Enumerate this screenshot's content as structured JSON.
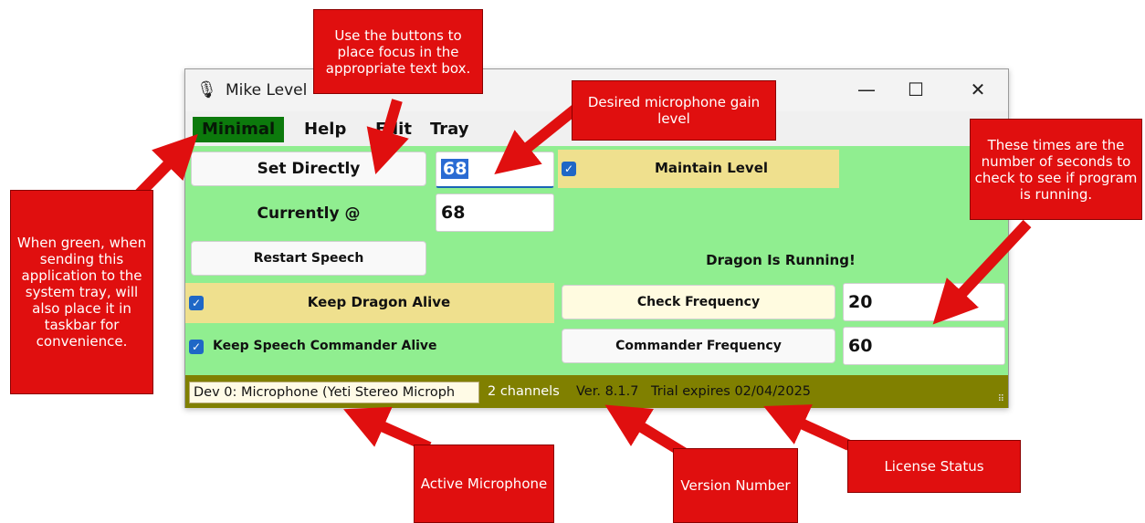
{
  "window": {
    "title": "Mike Level",
    "minimize_glyph": "—",
    "maximize_glyph": "☐",
    "close_glyph": "✕",
    "app_icon": "microphone-icon"
  },
  "menu": {
    "items": [
      "Minimal",
      "Help",
      "Edit",
      "Tray"
    ]
  },
  "controls": {
    "set_directly": "Set Directly",
    "gain_value": "68",
    "maintain_level": "Maintain Level",
    "currently_label": "Currently @",
    "current_value": "68",
    "restart_speech": "Restart Speech",
    "dragon_status": "Dragon Is Running!",
    "keep_dragon_alive": "Keep Dragon Alive",
    "check_frequency": "Check Frequency",
    "check_frequency_value": "20",
    "keep_speech_commander_alive": "Keep Speech Commander Alive",
    "commander_frequency": "Commander Frequency",
    "commander_frequency_value": "60"
  },
  "status": {
    "device": "Dev 0: Microphone (Yeti Stereo Microph",
    "channels": "2 channels",
    "version": "Ver. 8.1.7",
    "license": "Trial expires 02/04/2025"
  },
  "callouts": {
    "buttons_focus": "Use the buttons to place focus in the appropriate text box.",
    "gain_level": "Desired microphone gain level",
    "times": "These times are the number of seconds to check to see if program is running.",
    "green_tray": "When green, when sending this application to the system tray, will also place it in taskbar for convenience.",
    "active_mic": "Active Microphone",
    "version_number": "Version Number",
    "license_status": "License Status"
  },
  "colors": {
    "window_bg": "#90ee90",
    "status_bg": "#808000",
    "callout_red": "#e00f0f",
    "minimal_green": "#0c7a0c",
    "panel_yellow": "#efe08e",
    "check_blue": "#1f67c6"
  }
}
